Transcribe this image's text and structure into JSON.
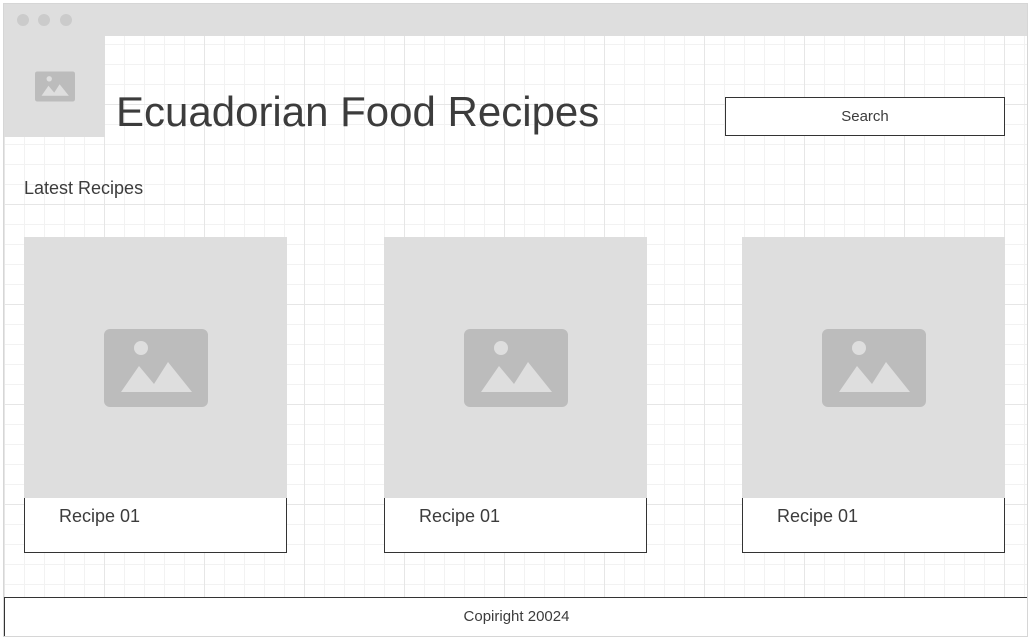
{
  "window": {
    "controls": [
      "close-dot",
      "minimize-dot",
      "maximize-dot"
    ]
  },
  "header": {
    "logo_icon": "image-placeholder-icon",
    "title": "Ecuadorian Food Recipes",
    "search_label": "Search"
  },
  "main": {
    "section_heading": "Latest Recipes",
    "cards": [
      {
        "image_icon": "image-placeholder-icon",
        "label": "Recipe 01"
      },
      {
        "image_icon": "image-placeholder-icon",
        "label": "Recipe 01"
      },
      {
        "image_icon": "image-placeholder-icon",
        "label": "Recipe 01"
      }
    ]
  },
  "footer": {
    "text": "Copiright 20024"
  },
  "colors": {
    "placeholder_bg": "#dedede",
    "placeholder_icon": "#bcbcbc",
    "text": "#3c3c3c",
    "border": "#333333"
  }
}
